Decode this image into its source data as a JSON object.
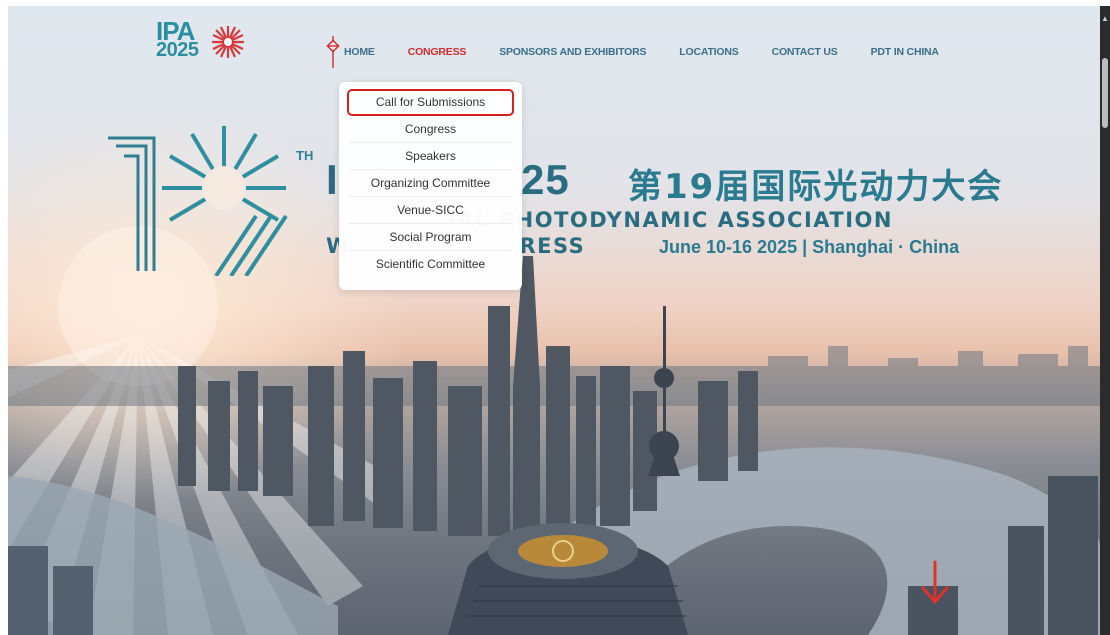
{
  "logo": {
    "line1": "IPA",
    "line2": "2025"
  },
  "nav": {
    "items": [
      {
        "label": "HOME"
      },
      {
        "label": "CONGRESS"
      },
      {
        "label": "SPONSORS AND EXHIBITORS"
      },
      {
        "label": "LOCATIONS"
      },
      {
        "label": "CONTACT US"
      },
      {
        "label": "PDT IN CHINA"
      }
    ],
    "active_index": 1
  },
  "dropdown": {
    "items": [
      {
        "label": "Call for Submissions"
      },
      {
        "label": "Congress"
      },
      {
        "label": "Speakers"
      },
      {
        "label": "Organizing Committee"
      },
      {
        "label": "Venue-SICC"
      },
      {
        "label": "Social Program"
      },
      {
        "label": "Scientific Committee"
      }
    ],
    "highlighted_index": 0
  },
  "banner": {
    "ordinal_suffix": "TH",
    "year_part": "25",
    "left_letter": "I",
    "cn_title": "第19届国际光动力大会",
    "line_assoc": "IAL PHOTODYNAMIC ASSOCIATION",
    "line_congress": "RESS",
    "line_congress_prefix": "W",
    "dates": "June 10-16 2025 | Shanghai · China"
  },
  "colors": {
    "accent_teal": "#2a7a90",
    "active_red": "#d12b2b",
    "nav_text": "#3b6f88",
    "highlight_border": "#d62020"
  },
  "icons": {
    "home": "chinese-knot-icon",
    "scroll_down": "down-arrow-icon",
    "logo_mark": "starburst-icon"
  }
}
